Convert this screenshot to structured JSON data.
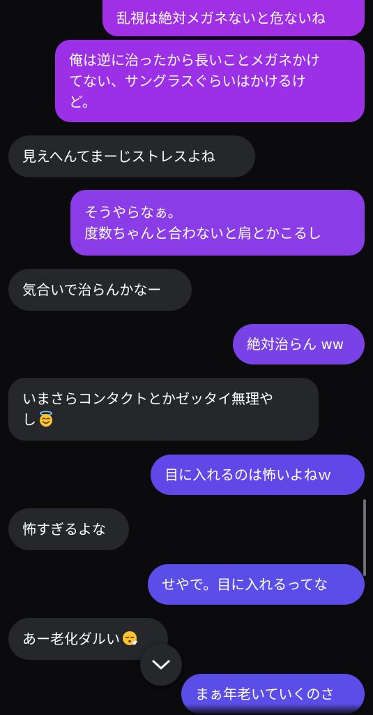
{
  "messages": [
    {
      "side": "out",
      "text": "乱視は絶対メガネないと危ないね"
    },
    {
      "side": "out",
      "text": "俺は逆に治ったから長いことメガネかけ\nてない、サングラスぐらいはかけるけ\nど。"
    },
    {
      "side": "in",
      "text": "見えへんてまーじストレスよね"
    },
    {
      "side": "out",
      "text": "そうやらなぁ。\n度数ちゃんと合わないと肩とかこるし"
    },
    {
      "side": "in",
      "text": "気合いで治らんかなー"
    },
    {
      "side": "out",
      "text": "絶対治らん ww"
    },
    {
      "side": "in",
      "text": "いまさらコンタクトとかゼッタイ無理や\nし",
      "emoji": "smiling-face-with-halo"
    },
    {
      "side": "out",
      "text": "目に入れるのは怖いよねｗ"
    },
    {
      "side": "in",
      "text": "怖すぎるよな"
    },
    {
      "side": "out",
      "text": "せやで。目に入れるってな"
    },
    {
      "side": "in",
      "text": "あー老化ダルい",
      "emoji": "face-exhaling"
    },
    {
      "side": "out",
      "text": "まぁ年老いていくのさ"
    }
  ],
  "colors": {
    "background": "#0b0b0d",
    "incoming_bubble": "#26272b",
    "outgoing_gradient": [
      "#a52fe6",
      "#5b4ee8"
    ],
    "text": "#ffffff"
  },
  "controls": {
    "scroll_to_bottom_icon": "chevron-down-icon"
  }
}
